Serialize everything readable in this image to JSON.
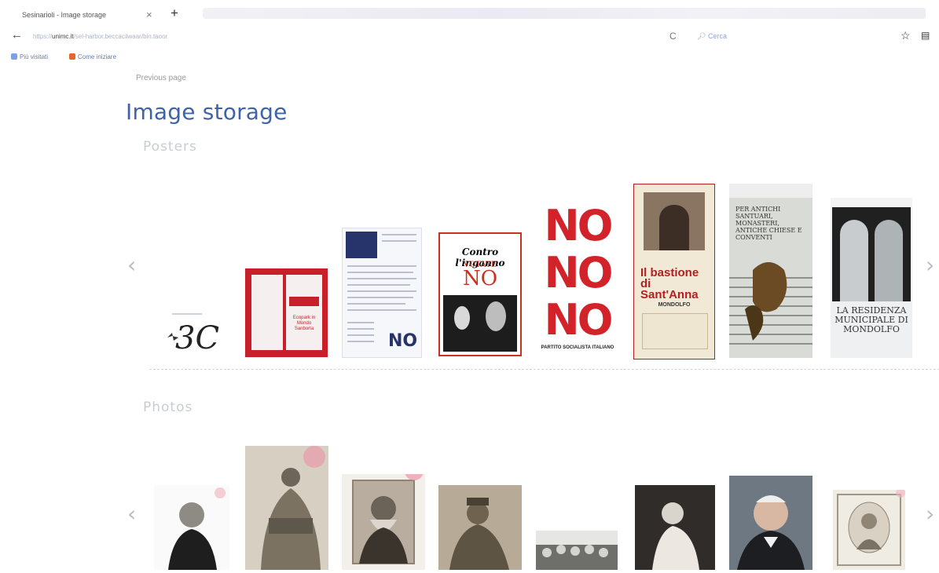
{
  "browser": {
    "tab_title": "Sesinarioli - Image storage",
    "tab_close": "×",
    "new_tab": "+",
    "back": "←",
    "url_host": "unimc.it",
    "url_rest": "/sel-harbor.beccacilwaar/bin.taoor",
    "url_prefix": "https://",
    "reload": "C",
    "search_label": "Cerca",
    "star": "☆",
    "library": "▤",
    "bookmarks": [
      "Più visitati",
      "Come iniziare"
    ]
  },
  "page": {
    "previous_link": "Previous page",
    "title": "Image storage",
    "sections": {
      "posters": "Posters",
      "photos": "Photos"
    },
    "arrow_left": "‹",
    "arrow_right": "›"
  },
  "posters": [
    {
      "text": "3C"
    },
    {
      "text": "Ecopark in Mondo Sanborta"
    },
    {
      "text": "NO"
    },
    {
      "top": "Contro l'inganno",
      "mid": "VOTATE",
      "big": "NO"
    },
    {
      "words": [
        "NO",
        "NO",
        "NO"
      ],
      "footer": "PARTITO SOCIALISTA ITALIANO"
    },
    {
      "title": "Il bastione di Sant'Anna",
      "sub": "MONDOLFO"
    },
    {
      "text": "PER ANTICHI SANTUARI, MONASTERI, ANTICHE CHIESE E CONVENTI"
    },
    {
      "text": "LA RESIDENZA MUNICIPALE DI MONDOLFO"
    }
  ],
  "colors": {
    "title_blue": "#3f63a8",
    "section_grey": "#c9ccd2",
    "poster_red": "#c7202b"
  }
}
